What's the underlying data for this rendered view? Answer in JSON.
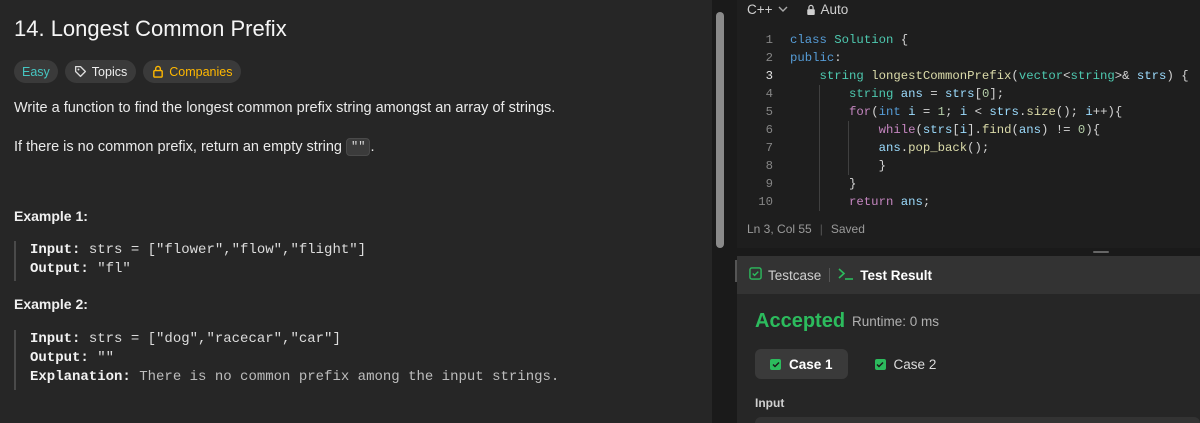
{
  "problem": {
    "title": "14. Longest Common Prefix",
    "tags": {
      "difficulty": "Easy",
      "topics": "Topics",
      "companies": "Companies"
    },
    "description_1": "Write a function to find the longest common prefix string amongst an array of strings.",
    "description_2_before": "If there is no common prefix, return an empty string ",
    "description_2_code": "\"\"",
    "description_2_after": ".",
    "examples": [
      {
        "heading": "Example 1:",
        "input_label": "Input:",
        "input_value": " strs = [\"flower\",\"flow\",\"flight\"]",
        "output_label": "Output:",
        "output_value": " \"fl\""
      },
      {
        "heading": "Example 2:",
        "input_label": "Input:",
        "input_value": " strs = [\"dog\",\"racecar\",\"car\"]",
        "output_label": "Output:",
        "output_value": " \"\"",
        "explanation_label": "Explanation:",
        "explanation_value": " There is no common prefix among the input strings."
      }
    ]
  },
  "editor": {
    "language": "C++",
    "mode": "Auto",
    "line_numbers": [
      "1",
      "2",
      "3",
      "4",
      "5",
      "6",
      "7",
      "8",
      "9",
      "10"
    ],
    "status_position": "Ln 3, Col 55",
    "status_saved": "Saved"
  },
  "test_result": {
    "tab_testcase": "Testcase",
    "tab_result": "Test Result",
    "verdict": "Accepted",
    "runtime": "Runtime: 0 ms",
    "cases": [
      "Case 1",
      "Case 2"
    ],
    "input_label": "Input"
  },
  "colors": {
    "accepted": "#2cbb5d",
    "easy": "#46c6c2",
    "companies": "#ffb800"
  }
}
